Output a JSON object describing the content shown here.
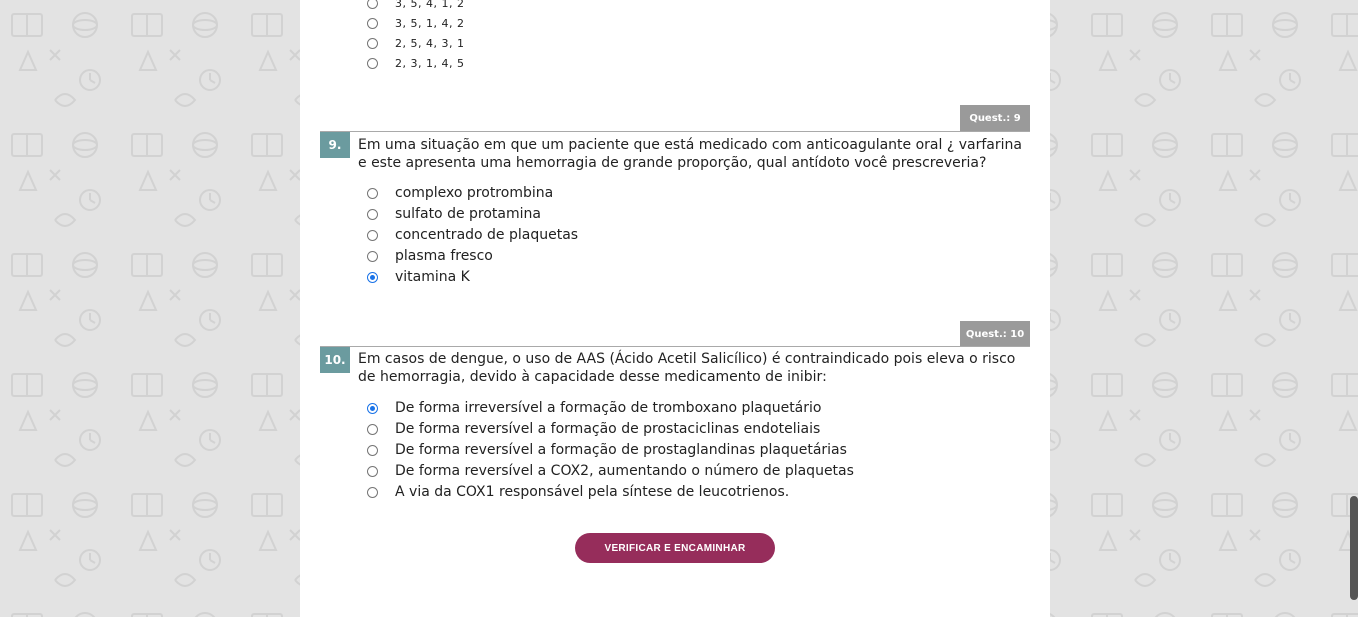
{
  "colors": {
    "background": "#e3e3e3",
    "question_number_bg": "#6b9b9f",
    "quest_tag_bg": "#9a9a9a",
    "submit_button": "#962d5b",
    "radio_checked": "#1a73e8"
  },
  "previous_question": {
    "options": [
      {
        "label": "3, 5, 4, 1, 2",
        "checked": false
      },
      {
        "label": "3, 5, 1, 4, 2",
        "checked": false
      },
      {
        "label": "2, 5, 4, 3, 1",
        "checked": false
      },
      {
        "label": "2, 3, 1, 4, 5",
        "checked": false
      }
    ]
  },
  "questions": [
    {
      "tag": "Quest.: 9",
      "number": "9.",
      "text": "Em uma situação em que um paciente que está medicado com anticoagulante oral ¿ varfarina e este apresenta uma hemorragia de grande proporção, qual antídoto você prescreveria?",
      "options": [
        {
          "label": "complexo protrombina",
          "checked": false
        },
        {
          "label": "sulfato de protamina",
          "checked": false
        },
        {
          "label": "concentrado de plaquetas",
          "checked": false
        },
        {
          "label": "plasma fresco",
          "checked": false
        },
        {
          "label": "vitamina K",
          "checked": true
        }
      ]
    },
    {
      "tag": "Quest.: 10",
      "number": "10.",
      "text": "Em casos de dengue, o uso de AAS (Ácido Acetil Salicílico) é contraindicado pois eleva o risco de hemorragia, devido à capacidade desse medicamento de inibir:",
      "options": [
        {
          "label": "De forma irreversível a formação de tromboxano plaquetário",
          "checked": true
        },
        {
          "label": "De forma reversível a formação de prostaciclinas endoteliais",
          "checked": false
        },
        {
          "label": "De forma reversível a formação de prostaglandinas plaquetárias",
          "checked": false
        },
        {
          "label": "De forma reversível a COX2, aumentando o número de plaquetas",
          "checked": false
        },
        {
          "label": "A via da COX1 responsável pela síntese de leucotrienos.",
          "checked": false
        }
      ]
    }
  ],
  "submit_button": {
    "label": "VERIFICAR E ENCAMINHAR"
  },
  "background_pattern": "doodle-science-icons"
}
